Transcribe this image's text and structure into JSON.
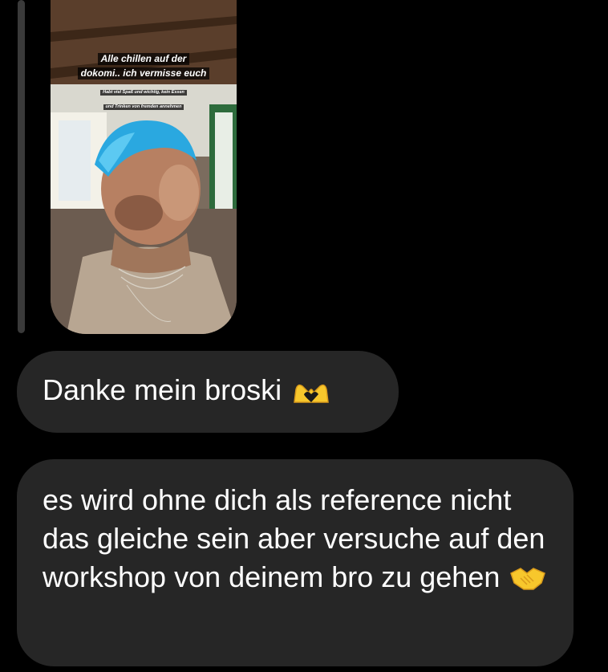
{
  "story_reply": {
    "caption_line_1": "Alle chillen auf der",
    "caption_line_2": "dokomi.. ich vermisse euch",
    "small_line_1": "Habt viel Spaß und wichtig, kein Essen",
    "small_line_2": "und Trinken von fremden annehmen"
  },
  "messages": [
    {
      "text": "Danke mein broski",
      "emoji": "heart-hands-icon"
    },
    {
      "text": "es wird ohne dich als reference nicht das gleiche sein aber versuche auf den workshop von deinem bro zu gehen",
      "emoji": "handshake-icon"
    }
  ],
  "colors": {
    "background": "#000000",
    "bubble": "#262626",
    "reply_bar": "#3a3a3a",
    "hair": "#2aa8e0",
    "emoji_yellow": "#f7c72c"
  }
}
